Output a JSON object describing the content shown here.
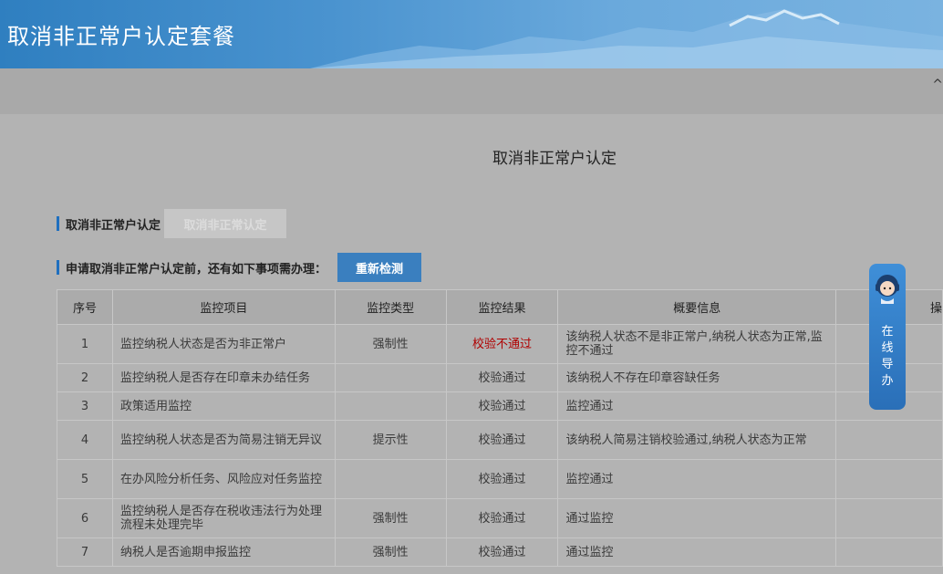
{
  "header": {
    "title": "取消非正常户认定套餐"
  },
  "strip": {
    "glyph": "^"
  },
  "section_title": "取消非正常户认定",
  "cancel_row": {
    "label": "取消非正常户认定",
    "button": "取消非正常认定"
  },
  "check_row": {
    "label": "申请取消非正常户认定前，还有如下事项需办理：",
    "button": "重新检测"
  },
  "table": {
    "headers": [
      "序号",
      "监控项目",
      "监控类型",
      "监控结果",
      "概要信息",
      "操"
    ],
    "rows": [
      {
        "no": "1",
        "item": "监控纳税人状态是否为非正常户",
        "type": "强制性",
        "result": "校验不通过",
        "info": "该纳税人状态不是非正常户,纳税人状态为正常,监控不通过"
      },
      {
        "no": "2",
        "item": "监控纳税人是否存在印章未办结任务",
        "type": "",
        "result": "校验通过",
        "info": "该纳税人不存在印章容缺任务"
      },
      {
        "no": "3",
        "item": "政策适用监控",
        "type": "",
        "result": "校验通过",
        "info": "监控通过"
      },
      {
        "no": "4",
        "item": "监控纳税人状态是否为简易注销无异议",
        "type": "提示性",
        "result": "校验通过",
        "info": "该纳税人简易注销校验通过,纳税人状态为正常"
      },
      {
        "no": "5",
        "item": "在办风险分析任务、风险应对任务监控",
        "type": "",
        "result": "校验通过",
        "info": "监控通过"
      },
      {
        "no": "6",
        "item": "监控纳税人是否存在税收违法行为处理流程未处理完毕",
        "type": "强制性",
        "result": "校验通过",
        "info": "通过监控"
      },
      {
        "no": "7",
        "item": "纳税人是否逾期申报监控",
        "type": "强制性",
        "result": "校验通过",
        "info": "通过监控"
      }
    ]
  },
  "float_nav": {
    "text": "在线导办",
    "chars": [
      "在",
      "线",
      "导",
      "办"
    ]
  },
  "colors": {
    "header": "#3a88c8",
    "fail": "#b00000",
    "primary_button": "#3a7fbf"
  }
}
